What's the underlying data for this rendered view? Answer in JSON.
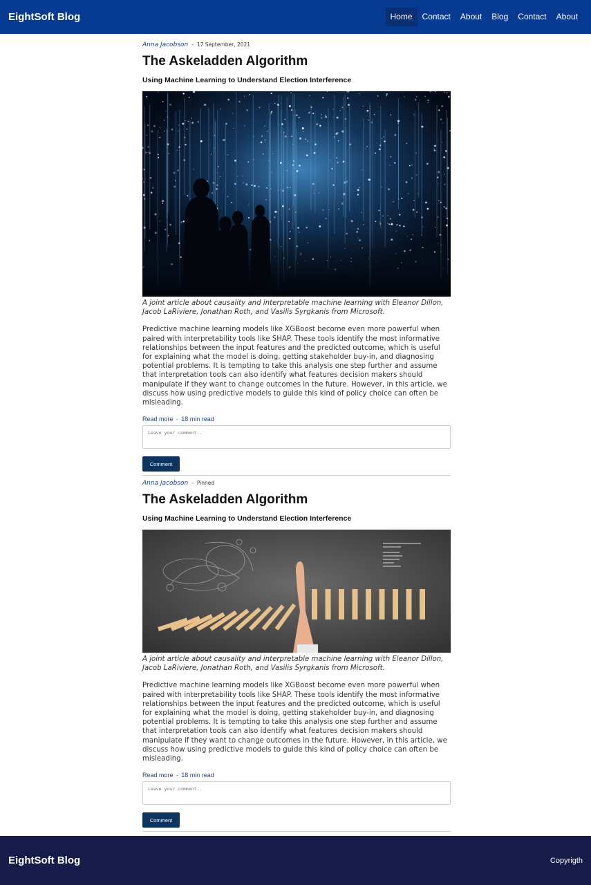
{
  "header": {
    "brand": "EightSoft Blog",
    "nav": [
      "Home",
      "Contact",
      "About",
      "Blog",
      "Contact",
      "About"
    ],
    "active_index": 0
  },
  "posts": [
    {
      "author": "Anna Jacobson",
      "meta_sep": "-",
      "tag": "17 September, 2021",
      "title": "The Askeladden Algorithm",
      "subtitle": "Using Machine Learning to Understand Election Interference",
      "image": "dark-room-with-data-lights-and-silhouettes",
      "caption": "A joint article about causality and interpretable machine learning with Eleanor Dillon, Jacob LaRiviere, Jonathan Roth, and Vasilis Syrgkanis from Microsoft.",
      "body": "Predictive machine learning models like XGBoost become even more powerful when paired with interpretability tools like SHAP. These tools identify the most informative relationships between the input features and the predicted outcome, which is useful for explaining what the model is doing, getting stakeholder buy-in, and diagnosing potential problems. It is tempting to take this analysis one step further and assume that interpretation tools can also identify what features decision makers should manipulate if they want to change outcomes in the future. However, in this article, we discuss how using predictive models to guide this kind of policy choice can often be misleading.",
      "read_more": "Read more",
      "read_time": "18 min read",
      "comment_placeholder": "Leave your comment..",
      "comment_button": "Comment"
    },
    {
      "author": "Anna Jacobson",
      "meta_sep": "-",
      "tag": "Pinned",
      "title": "The Askeladden Algorithm",
      "subtitle": "Using Machine Learning to Understand Election Interference",
      "image": "hand-stopping-falling-dominoes",
      "caption": "A joint article about causality and interpretable machine learning with Eleanor Dillon, Jacob LaRiviere, Jonathan Roth, and Vasilis Syrgkanis from Microsoft.",
      "body": "Predictive machine learning models like XGBoost become even more powerful when paired with interpretability tools like SHAP. These tools identify the most informative relationships between the input features and the predicted outcome, which is useful for explaining what the model is doing, getting stakeholder buy-in, and diagnosing potential problems. It is tempting to take this analysis one step further and assume that interpretation tools can also identify what features decision makers should manipulate if they want to change outcomes in the future. However, in this article, we discuss how using predictive models to guide this kind of policy choice can often be misleading.",
      "read_more": "Read more",
      "read_time": "18 min read",
      "comment_placeholder": "Leave your comment..",
      "comment_button": "Comment"
    }
  ],
  "footer": {
    "brand": "EightSoft Blog",
    "copyright": "Copyrigth"
  },
  "colors": {
    "navbar": "#073b91",
    "footer": "#171c4a",
    "button": "#0d335f",
    "link": "#23457f"
  }
}
